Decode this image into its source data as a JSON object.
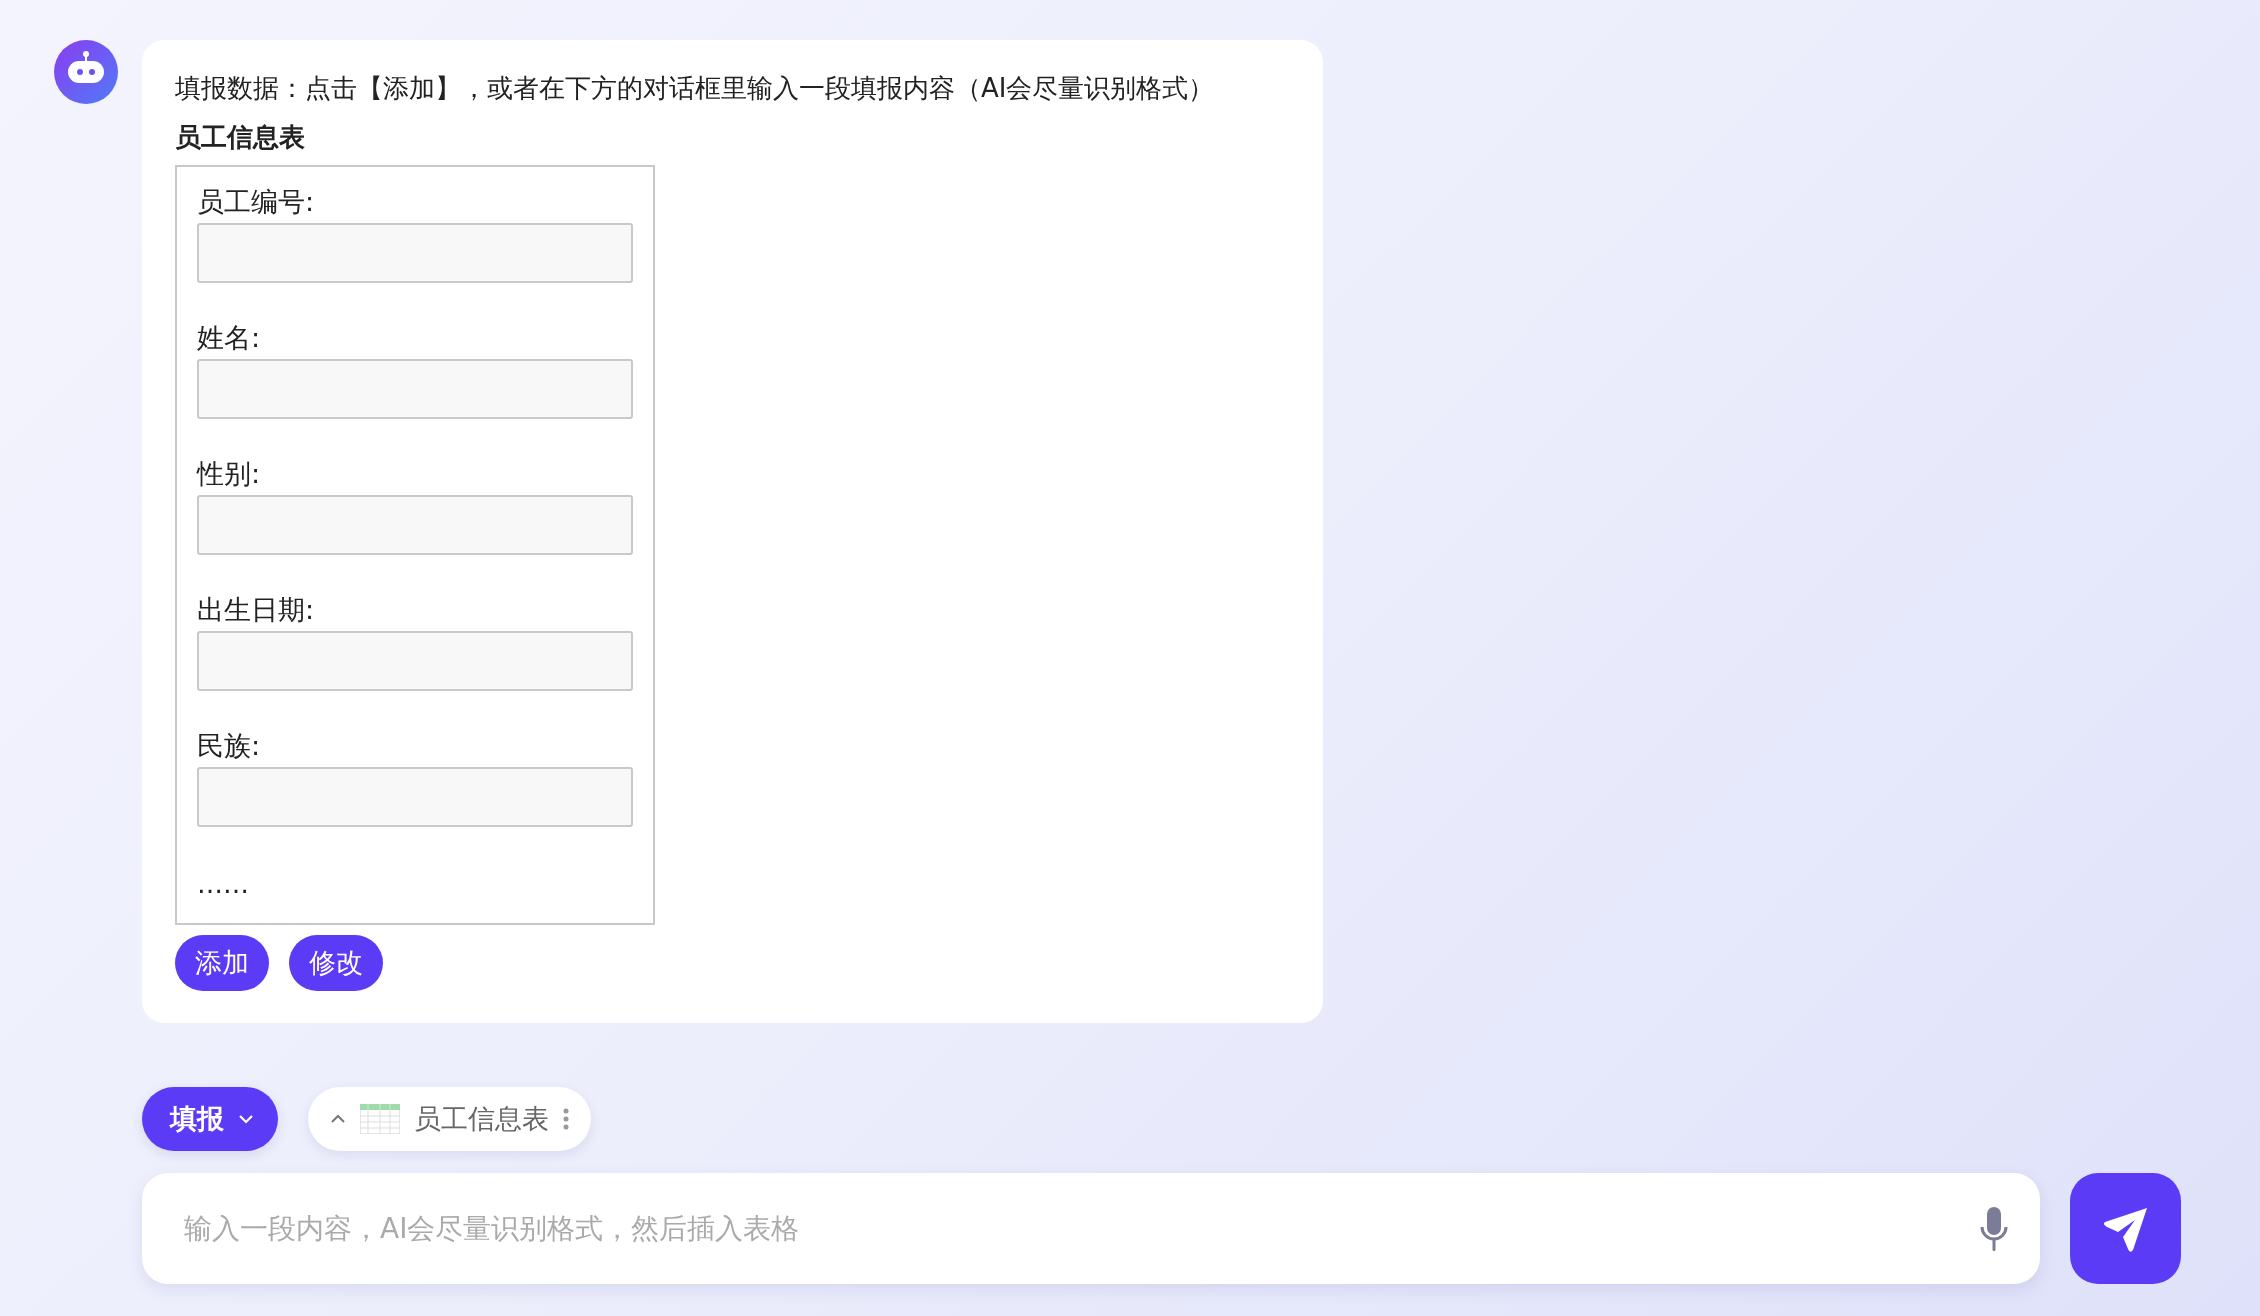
{
  "message": {
    "intro": "填报数据：点击【添加】，或者在下方的对话框里输入一段填报内容（AI会尽量识别格式）",
    "form_title": "员工信息表",
    "fields": [
      {
        "label": "员工编号:"
      },
      {
        "label": "姓名:"
      },
      {
        "label": "性别:"
      },
      {
        "label": "出生日期:"
      },
      {
        "label": "民族:"
      }
    ],
    "more": "……",
    "buttons": [
      "添加",
      "修改"
    ]
  },
  "toolbar": {
    "mode_button": "填报",
    "table_chip": "员工信息表"
  },
  "composer": {
    "placeholder": "输入一段内容，AI会尽量识别格式，然后插入表格"
  }
}
